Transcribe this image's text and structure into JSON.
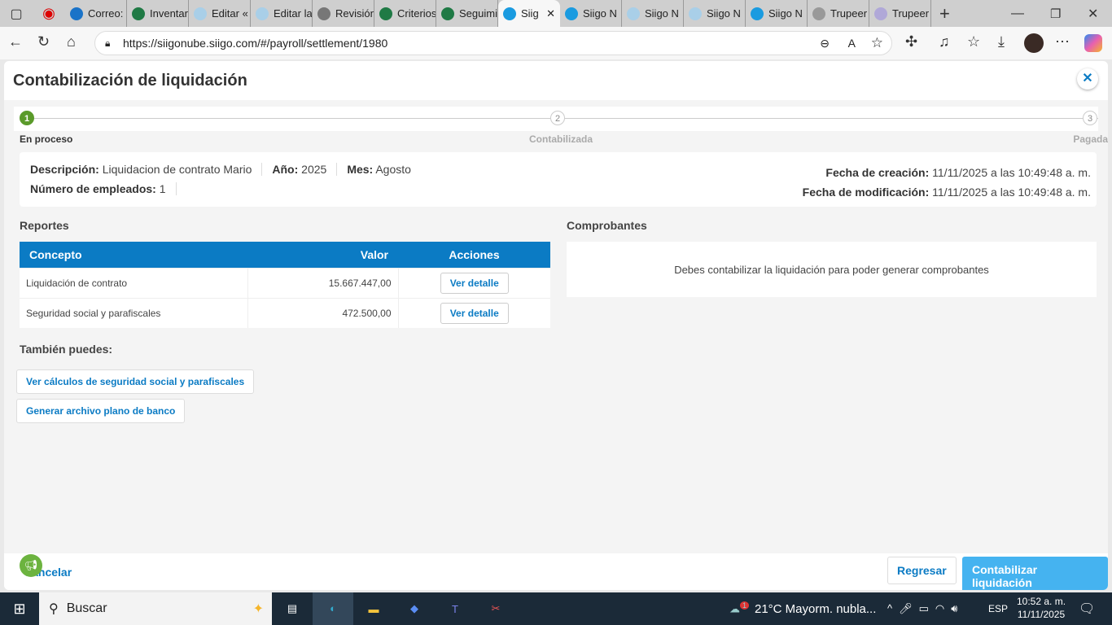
{
  "browser": {
    "tabs": [
      {
        "label": "Correo:",
        "color": "#1a73c8"
      },
      {
        "label": "Inventar",
        "color": "#1f7a45"
      },
      {
        "label": "Editar «",
        "color": "#a9cfe8"
      },
      {
        "label": "Editar la",
        "color": "#a9cfe8"
      },
      {
        "label": "Revisión",
        "color": "#777"
      },
      {
        "label": "Criterios",
        "color": "#1f7a45"
      },
      {
        "label": "Seguimi",
        "color": "#1f7a45"
      },
      {
        "label": "Siig",
        "color": "#1a9be0",
        "active": true
      },
      {
        "label": "Siigo N",
        "color": "#1a9be0"
      },
      {
        "label": "Siigo N",
        "color": "#a9cfe8"
      },
      {
        "label": "Siigo N",
        "color": "#a9cfe8"
      },
      {
        "label": "Siigo N",
        "color": "#1a9be0"
      },
      {
        "label": "Trupeer",
        "color": "#999"
      },
      {
        "label": "Trupeer",
        "color": "#b0a8d8"
      }
    ],
    "url": "https://siigonube.siigo.com/#/payroll/settlement/1980"
  },
  "modal": {
    "title": "Contabilización de liquidación",
    "steps": [
      {
        "num": "1",
        "label": "En proceso",
        "active": true
      },
      {
        "num": "2",
        "label": "Contabilizada"
      },
      {
        "num": "3",
        "label": "Pagada"
      }
    ],
    "info": {
      "descripcion_label": "Descripción:",
      "descripcion": "Liquidacion de contrato Mario",
      "anio_label": "Año:",
      "anio": "2025",
      "mes_label": "Mes:",
      "mes": "Agosto",
      "empleados_label": "Número de empleados:",
      "empleados": "1",
      "creacion_label": "Fecha de creación:",
      "creacion": "11/11/2025 a las 10:49:48 a. m.",
      "modificacion_label": "Fecha de modificación:",
      "modificacion": "11/11/2025 a las 10:49:48 a. m."
    },
    "reportes": {
      "title": "Reportes",
      "headers": [
        "Concepto",
        "Valor",
        "Acciones"
      ],
      "rows": [
        {
          "concepto": "Liquidación de contrato",
          "valor": "15.667.447,00",
          "action": "Ver detalle"
        },
        {
          "concepto": "Seguridad social y parafiscales",
          "valor": "472.500,00",
          "action": "Ver detalle"
        }
      ]
    },
    "comprobantes": {
      "title": "Comprobantes",
      "message": "Debes contabilizar la liquidación para poder generar comprobantes"
    },
    "tambien": {
      "title": "También puedes:",
      "links": [
        "Ver cálculos de seguridad social y parafiscales",
        "Generar archivo plano de banco"
      ]
    },
    "footer": {
      "cancel": "Cancelar",
      "back": "Regresar",
      "primary": "Contabilizar liquidación"
    }
  },
  "taskbar": {
    "search": "Buscar",
    "weather": "21°C  Mayorm. nubla...",
    "weather_badge": "1",
    "lang": "ESP",
    "time": "10:52 a. m.",
    "date": "11/11/2025"
  },
  "colors": {
    "primary": "#0b7bc4",
    "success": "#5a9a2a",
    "primary_button": "#45b3f0"
  }
}
